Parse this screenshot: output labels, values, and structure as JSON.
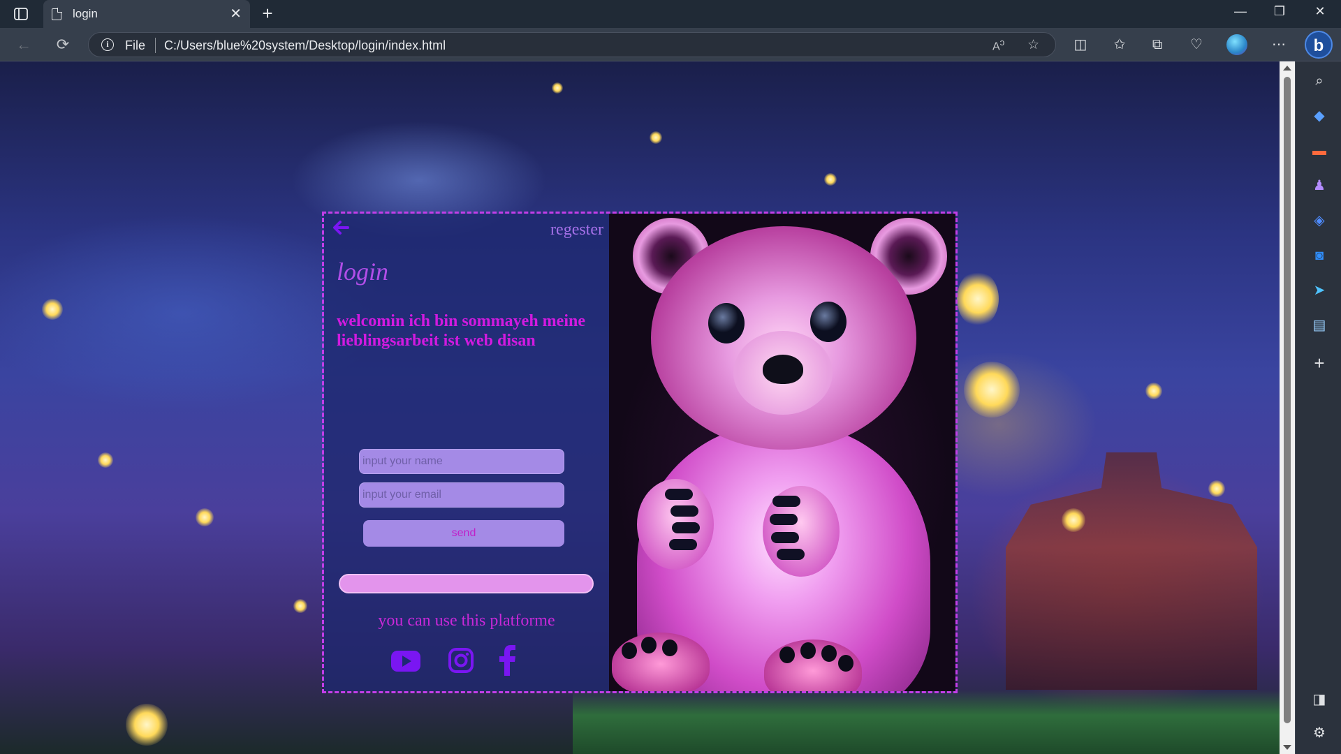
{
  "browser": {
    "tab_title": "login",
    "url_scheme_label": "File",
    "url": "C:/Users/blue%20system/Desktop/login/index.html"
  },
  "page": {
    "register_link": "regester",
    "title": "login",
    "welcome_text": "welcomin ich bin sommayeh meine lieblingsarbeit ist web disan",
    "name_placeholder": "input your name",
    "email_placeholder": "input your email",
    "send_label": "send",
    "platform_text": "you can use this platforme",
    "social_icons": [
      "youtube-icon",
      "instagram-icon",
      "facebook-icon"
    ]
  },
  "colors": {
    "accent_purple": "#7a16f2",
    "magenta_text": "#d21ae0",
    "input_bg": "#a48ae6",
    "card_border": "#c23ee8"
  }
}
